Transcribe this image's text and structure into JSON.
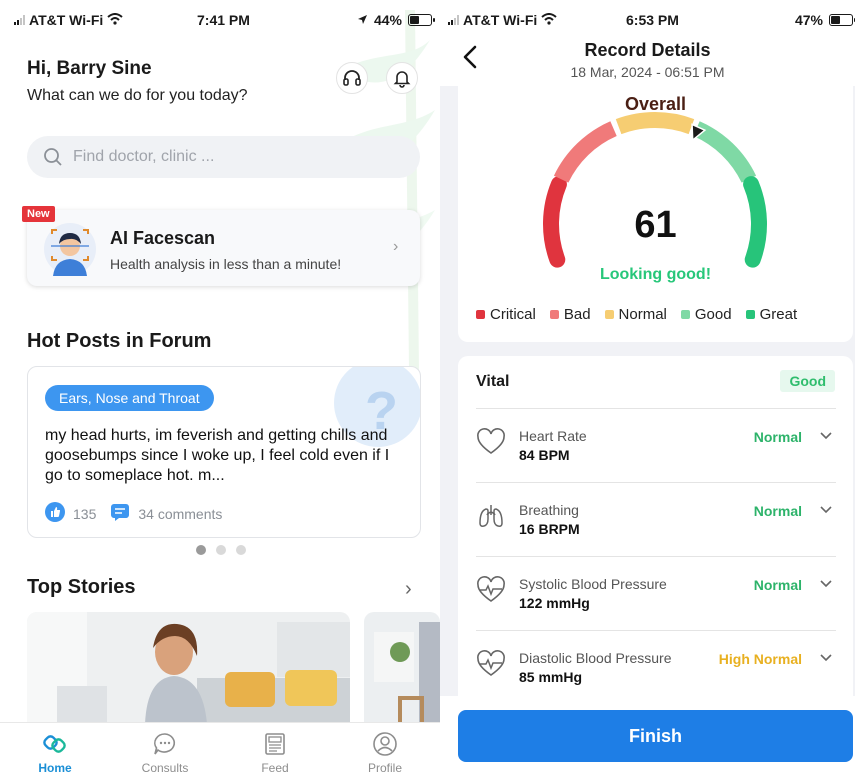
{
  "left": {
    "status": {
      "carrier": "AT&T Wi-Fi",
      "time": "7:41 PM",
      "battery": "44%",
      "battery_level": 0.44
    },
    "greeting": "Hi, Barry Sine",
    "subtitle": "What can we do for you today?",
    "icons": {
      "support": "headset-icon",
      "notifications": "bell-icon"
    },
    "search": {
      "placeholder": "Find doctor, clinic ..."
    },
    "ai_card": {
      "badge": "New",
      "title": "AI Facescan",
      "subtitle": "Health analysis in less than a minute!"
    },
    "forum": {
      "title": "Hot Posts in Forum",
      "post": {
        "tag": "Ears, Nose and Throat",
        "text": "my head hurts, im feverish and getting chills and goosebumps since I woke up, I feel cold even if I go to someplace hot. m...",
        "likes": "135",
        "comments": "34 comments"
      }
    },
    "top_stories": {
      "title": "Top Stories"
    },
    "tabs": [
      {
        "label": "Home",
        "icon": "home-icon"
      },
      {
        "label": "Consults",
        "icon": "chat-bubble-icon"
      },
      {
        "label": "Feed",
        "icon": "newspaper-icon"
      },
      {
        "label": "Profile",
        "icon": "person-icon"
      }
    ]
  },
  "right": {
    "status": {
      "carrier": "AT&T Wi-Fi",
      "time": "6:53 PM",
      "battery": "47%",
      "battery_level": 0.47
    },
    "header": {
      "title": "Record Details",
      "date": "18 Mar, 2024 - 06:51 PM"
    },
    "overall": {
      "title": "Overall",
      "score": "61",
      "score_value": 61,
      "verdict": "Looking good!",
      "legend": [
        {
          "label": "Critical",
          "color": "#e0343e"
        },
        {
          "label": "Bad",
          "color": "#f07a7a"
        },
        {
          "label": "Normal",
          "color": "#f6cd72"
        },
        {
          "label": "Good",
          "color": "#7fd9a5"
        },
        {
          "label": "Great",
          "color": "#27c47a"
        }
      ]
    },
    "vital": {
      "title": "Vital",
      "badge": "Good",
      "rows": [
        {
          "name": "Heart Rate",
          "value": "84 BPM",
          "status": "Normal",
          "status_color": "#2db36a",
          "icon": "heart-icon"
        },
        {
          "name": "Breathing",
          "value": "16 BRPM",
          "status": "Normal",
          "status_color": "#2db36a",
          "icon": "lungs-icon"
        },
        {
          "name": "Systolic Blood Pressure",
          "value": "122 mmHg",
          "status": "Normal",
          "status_color": "#2db36a",
          "icon": "heart-pulse-icon"
        },
        {
          "name": "Diastolic Blood Pressure",
          "value": "85 mmHg",
          "status": "High Normal",
          "status_color": "#e8b020",
          "icon": "heart-pulse-icon"
        }
      ]
    },
    "finish_label": "Finish"
  }
}
